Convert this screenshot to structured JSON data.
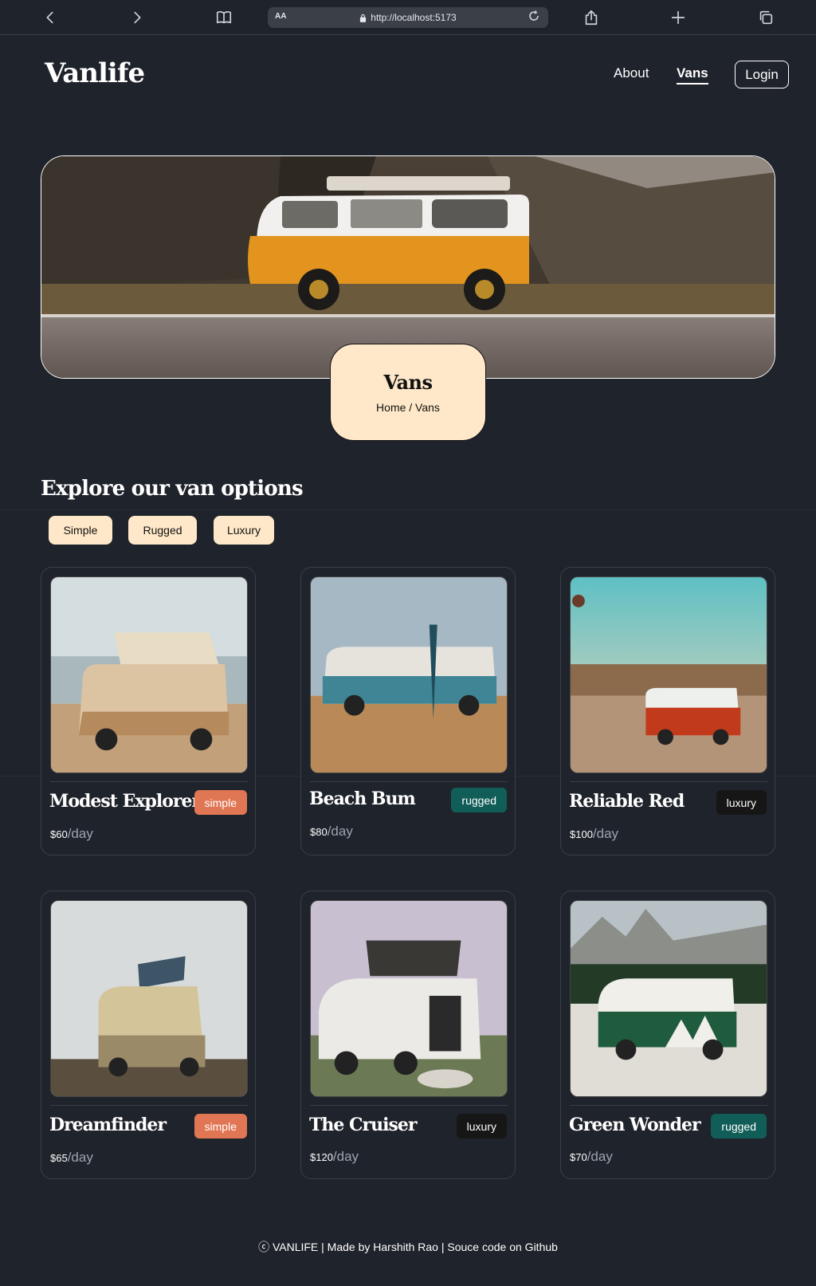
{
  "browser": {
    "aa_label": "AA",
    "url": "http://localhost:5173"
  },
  "header": {
    "logo": "Vanlife",
    "nav": {
      "about": "About",
      "vans": "Vans"
    },
    "login": "Login"
  },
  "hero": {
    "title": "Vans",
    "breadcrumb": "Home / Vans"
  },
  "section": {
    "title": "Explore our van options"
  },
  "filters": [
    "Simple",
    "Rugged",
    "Luxury"
  ],
  "vans": [
    {
      "name": "Modest Explorer",
      "type": "simple",
      "price": "$60",
      "unit": "/day"
    },
    {
      "name": "Beach Bum",
      "type": "rugged",
      "price": "$80",
      "unit": "/day"
    },
    {
      "name": "Reliable Red",
      "type": "luxury",
      "price": "$100",
      "unit": "/day"
    },
    {
      "name": "Dreamfinder",
      "type": "simple",
      "price": "$65",
      "unit": "/day"
    },
    {
      "name": "The Cruiser",
      "type": "luxury",
      "price": "$120",
      "unit": "/day"
    },
    {
      "name": "Green Wonder",
      "type": "rugged",
      "price": "$70",
      "unit": "/day"
    }
  ],
  "footer": {
    "text": "ⓒ VANLIFE | Made by Harshith Rao | Souce code on Github"
  },
  "colors": {
    "background": "#1f232b",
    "accent_cream": "#ffe8c9",
    "badge_simple": "#e17654",
    "badge_rugged": "#115e59",
    "badge_luxury": "#161616"
  }
}
